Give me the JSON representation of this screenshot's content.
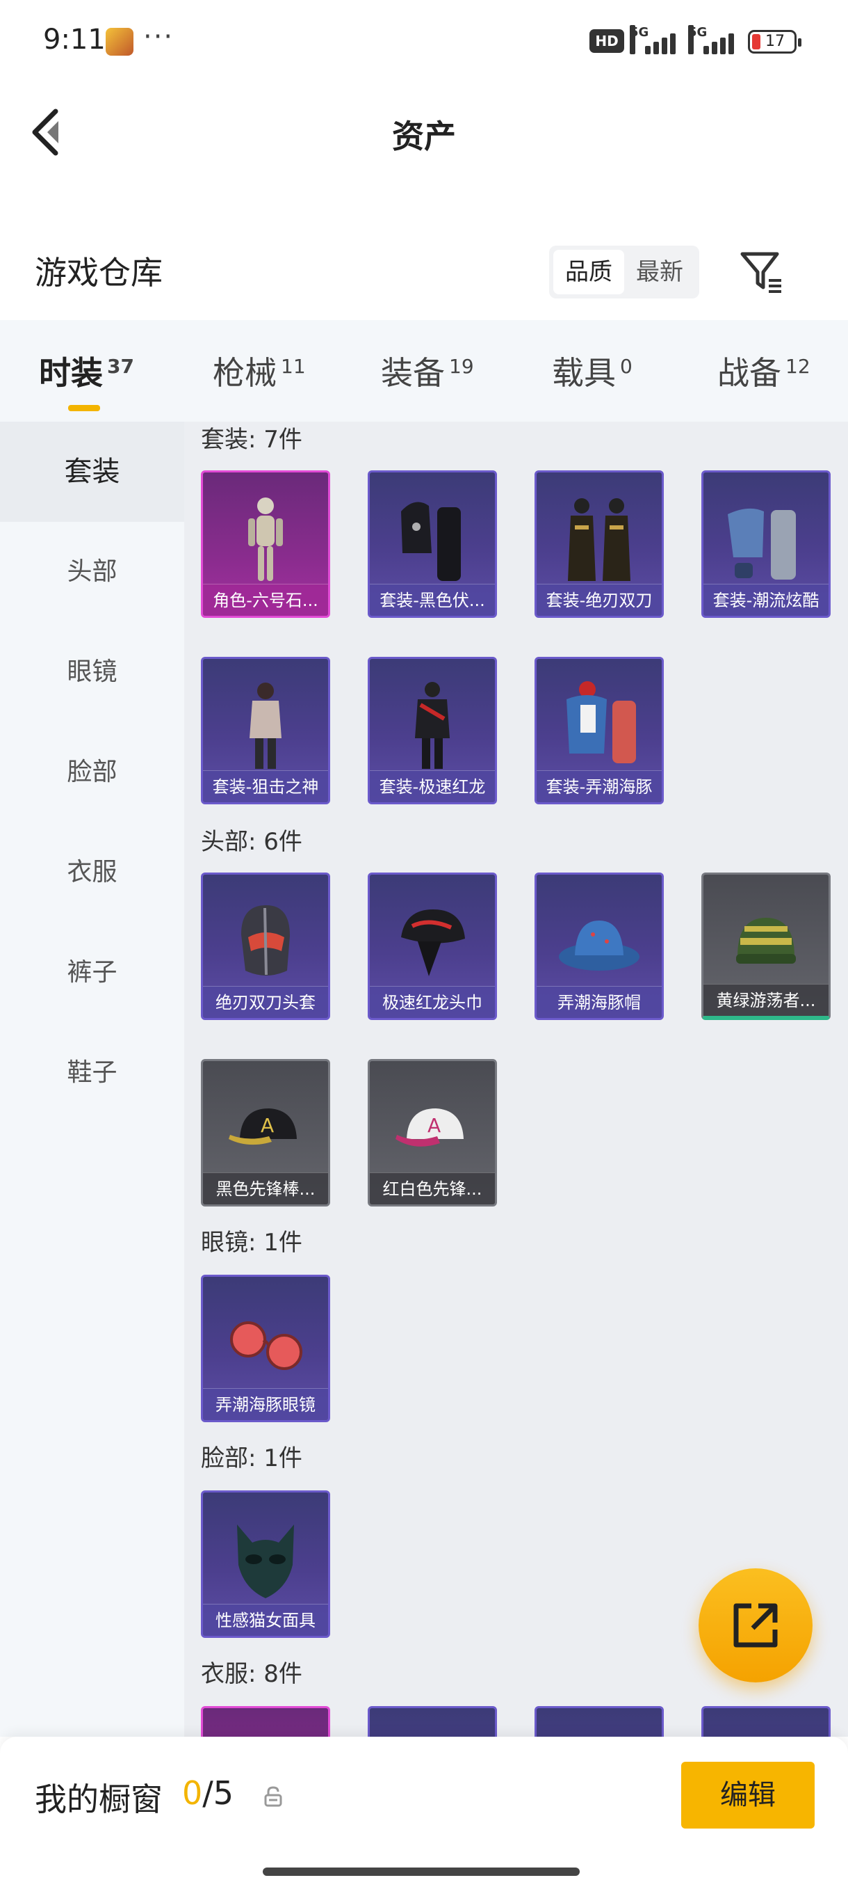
{
  "status_bar": {
    "time": "9:11",
    "more": "···",
    "hd": "HD",
    "sim1": "5G",
    "sim2": "5G",
    "battery": "17"
  },
  "header": {
    "title": "资产"
  },
  "warehouse": {
    "label": "游戏仓库",
    "sort_options": [
      "品质",
      "最新"
    ],
    "sort_active": "品质"
  },
  "tabs": [
    {
      "label": "时装",
      "count": "37",
      "active": true
    },
    {
      "label": "枪械",
      "count": "11",
      "active": false
    },
    {
      "label": "装备",
      "count": "19",
      "active": false
    },
    {
      "label": "载具",
      "count": "0",
      "active": false
    },
    {
      "label": "战备",
      "count": "12",
      "active": false
    }
  ],
  "sidebar": [
    {
      "label": "套装",
      "active": true
    },
    {
      "label": "头部",
      "active": false
    },
    {
      "label": "眼镜",
      "active": false
    },
    {
      "label": "脸部",
      "active": false
    },
    {
      "label": "衣服",
      "active": false
    },
    {
      "label": "裤子",
      "active": false
    },
    {
      "label": "鞋子",
      "active": false
    }
  ],
  "sections": [
    {
      "title": "套装: 7件",
      "items": [
        {
          "name": "角色-六号石...",
          "rarity": "pink",
          "icon": "character-icon"
        },
        {
          "name": "套装-黑色伏...",
          "rarity": "purple",
          "icon": "outfit-icon"
        },
        {
          "name": "套装-绝刃双刀",
          "rarity": "purple",
          "icon": "outfit-icon"
        },
        {
          "name": "套装-潮流炫酷",
          "rarity": "purple",
          "icon": "outfit-icon"
        },
        {
          "name": "套装-狙击之神",
          "rarity": "purple",
          "icon": "outfit-icon"
        },
        {
          "name": "套装-极速红龙",
          "rarity": "purple",
          "icon": "outfit-icon"
        },
        {
          "name": "套装-弄潮海豚",
          "rarity": "purple",
          "icon": "outfit-icon"
        }
      ]
    },
    {
      "title": "头部: 6件",
      "items": [
        {
          "name": "绝刃双刀头套",
          "rarity": "purple",
          "icon": "helmet-icon"
        },
        {
          "name": "极速红龙头巾",
          "rarity": "purple",
          "icon": "bandana-icon"
        },
        {
          "name": "弄潮海豚帽",
          "rarity": "purple",
          "icon": "bucket-hat-icon"
        },
        {
          "name": "黄绿游荡者...",
          "rarity": "gray-green",
          "icon": "beanie-icon"
        },
        {
          "name": "黑色先锋棒...",
          "rarity": "gray",
          "icon": "cap-icon"
        },
        {
          "name": "红白色先锋...",
          "rarity": "gray",
          "icon": "cap-icon"
        }
      ]
    },
    {
      "title": "眼镜: 1件",
      "items": [
        {
          "name": "弄潮海豚眼镜",
          "rarity": "purple",
          "icon": "glasses-icon"
        }
      ]
    },
    {
      "title": "脸部: 1件",
      "items": [
        {
          "name": "性感猫女面具",
          "rarity": "purple",
          "icon": "mask-icon"
        }
      ]
    },
    {
      "title": "衣服: 8件",
      "items": []
    }
  ],
  "bottom": {
    "label": "我的橱窗",
    "count_current": "0",
    "count_total": "/5",
    "edit_label": "编辑"
  },
  "colors": {
    "accent": "#f7b500",
    "rare_purple": "#6b5acb",
    "rare_pink": "#e14bd5",
    "common_gray": "#777980"
  }
}
